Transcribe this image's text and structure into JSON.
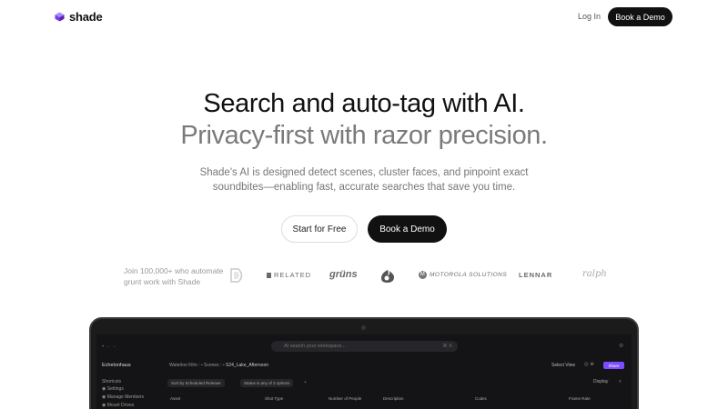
{
  "nav": {
    "brand": "shade",
    "login": "Log In",
    "book_demo": "Book a Demo"
  },
  "hero": {
    "line1": "Search and auto-tag with AI.",
    "line2": "Privacy-first with razor precision.",
    "sub_line1": "Shade's AI is designed detect scenes, cluster faces, and pinpoint exact",
    "sub_line2": "soundbites—enabling fast, accurate searches that save you time.",
    "start_free": "Start for Free",
    "book_demo": "Book a Demo"
  },
  "social_proof": {
    "line1": "Join 100,000+ who automate",
    "line2": "grunt work with Shade",
    "brands": [
      "RELATED",
      "grüns",
      "MOTOROLA SOLUTIONS",
      "LENNAR",
      "ralph"
    ]
  },
  "app": {
    "search_placeholder": "AI search your workspace...",
    "workspace": "Echelonhaus",
    "shortcuts": "Shortcuts",
    "settings": "Settings",
    "manage_members": "Manage Members",
    "mount_drives": "Mount Drives",
    "breadcrumb": [
      "Waterloo Film",
      "Scenes",
      "S24_Lake_Afternoon"
    ],
    "select_view": "Select View",
    "share": "Share",
    "sort_by": "Sort by Scheduled Release",
    "status_filter": "Status is any of 3 options",
    "display": "Display",
    "columns": [
      "Asset",
      "Shot Type",
      "Number of People",
      "Description",
      "Codec",
      "Frame Rate"
    ]
  },
  "colors": {
    "accent": "#7c4dff",
    "dark": "#111111"
  }
}
